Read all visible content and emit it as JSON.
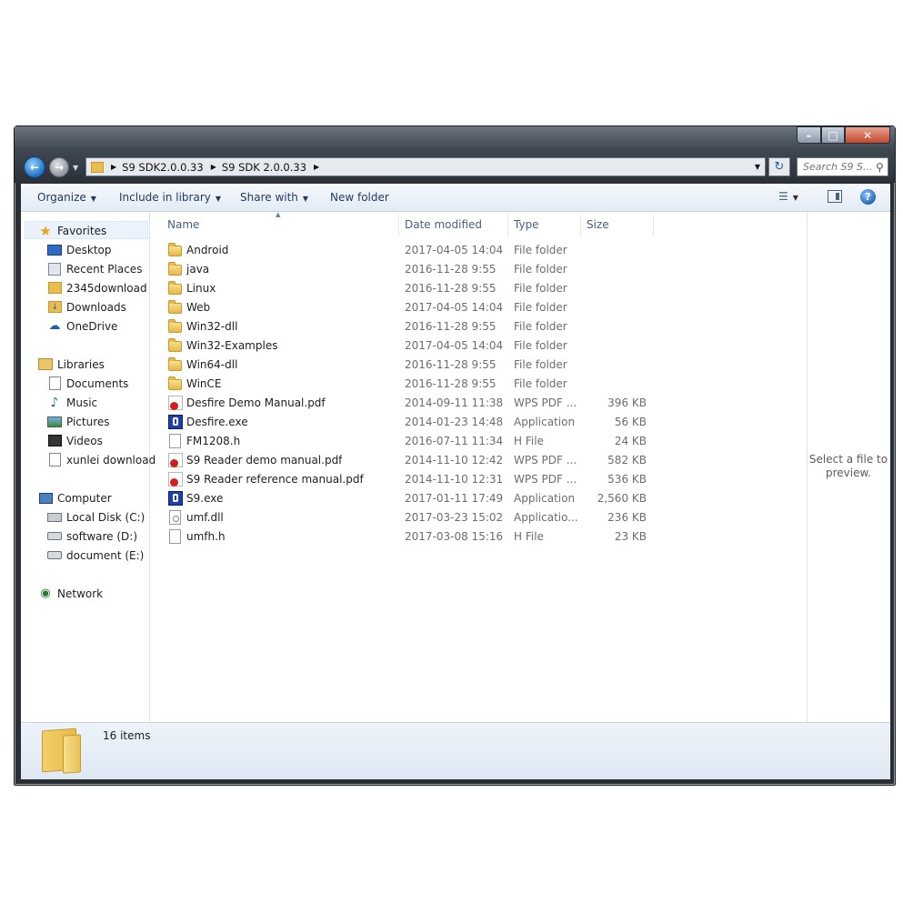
{
  "window": {
    "controls": [
      "minimize",
      "maximize",
      "close"
    ]
  },
  "address_bar": {
    "segments": [
      "S9 SDK2.0.0.33",
      "S9 SDK 2.0.0.33"
    ]
  },
  "search": {
    "placeholder": "Search S9 S..."
  },
  "toolbar": {
    "organize": "Organize",
    "include_in_library": "Include in library",
    "share_with": "Share with",
    "new_folder": "New folder"
  },
  "nav": {
    "favorites": {
      "label": "Favorites",
      "items": [
        "Desktop",
        "Recent Places",
        "2345download",
        "Downloads",
        "OneDrive"
      ]
    },
    "libraries": {
      "label": "Libraries",
      "items": [
        "Documents",
        "Music",
        "Pictures",
        "Videos",
        "xunlei download"
      ]
    },
    "computer": {
      "label": "Computer",
      "items": [
        "Local Disk (C:)",
        "software (D:)",
        "document (E:)"
      ]
    },
    "network": {
      "label": "Network"
    }
  },
  "columns": {
    "name": "Name",
    "date": "Date modified",
    "type": "Type",
    "size": "Size"
  },
  "files": [
    {
      "name": "Android",
      "date": "2017-04-05 14:04",
      "type": "File folder",
      "size": "",
      "icon": "folder-icon"
    },
    {
      "name": "java",
      "date": "2016-11-28 9:55",
      "type": "File folder",
      "size": "",
      "icon": "folder-icon"
    },
    {
      "name": "Linux",
      "date": "2016-11-28 9:55",
      "type": "File folder",
      "size": "",
      "icon": "folder-icon"
    },
    {
      "name": "Web",
      "date": "2017-04-05 14:04",
      "type": "File folder",
      "size": "",
      "icon": "folder-icon"
    },
    {
      "name": "Win32-dll",
      "date": "2016-11-28 9:55",
      "type": "File folder",
      "size": "",
      "icon": "folder-icon"
    },
    {
      "name": "Win32-Examples",
      "date": "2017-04-05 14:04",
      "type": "File folder",
      "size": "",
      "icon": "folder-icon"
    },
    {
      "name": "Win64-dll",
      "date": "2016-11-28 9:55",
      "type": "File folder",
      "size": "",
      "icon": "folder-icon"
    },
    {
      "name": "WinCE",
      "date": "2016-11-28 9:55",
      "type": "File folder",
      "size": "",
      "icon": "folder-icon"
    },
    {
      "name": "Desfire Demo Manual.pdf",
      "date": "2014-09-11 11:38",
      "type": "WPS PDF ...",
      "size": "396 KB",
      "icon": "pdf-icon"
    },
    {
      "name": "Desfire.exe",
      "date": "2014-01-23 14:48",
      "type": "Application",
      "size": "56 KB",
      "icon": "exe-icon"
    },
    {
      "name": "FM1208.h",
      "date": "2016-07-11 11:34",
      "type": "H File",
      "size": "24 KB",
      "icon": "h-file-icon"
    },
    {
      "name": "S9 Reader demo manual.pdf",
      "date": "2014-11-10 12:42",
      "type": "WPS PDF ...",
      "size": "582 KB",
      "icon": "pdf-icon"
    },
    {
      "name": "S9 Reader reference manual.pdf",
      "date": "2014-11-10 12:31",
      "type": "WPS PDF ...",
      "size": "536 KB",
      "icon": "pdf-icon"
    },
    {
      "name": "S9.exe",
      "date": "2017-01-11 17:49",
      "type": "Application",
      "size": "2,560 KB",
      "icon": "exe-icon"
    },
    {
      "name": "umf.dll",
      "date": "2017-03-23 15:02",
      "type": "Applicatio...",
      "size": "236 KB",
      "icon": "dll-icon"
    },
    {
      "name": "umfh.h",
      "date": "2017-03-08 15:16",
      "type": "H File",
      "size": "23 KB",
      "icon": "h-file-icon"
    }
  ],
  "preview": {
    "line1": "Select a file to",
    "line2": "preview."
  },
  "details": {
    "count": "16 items"
  }
}
